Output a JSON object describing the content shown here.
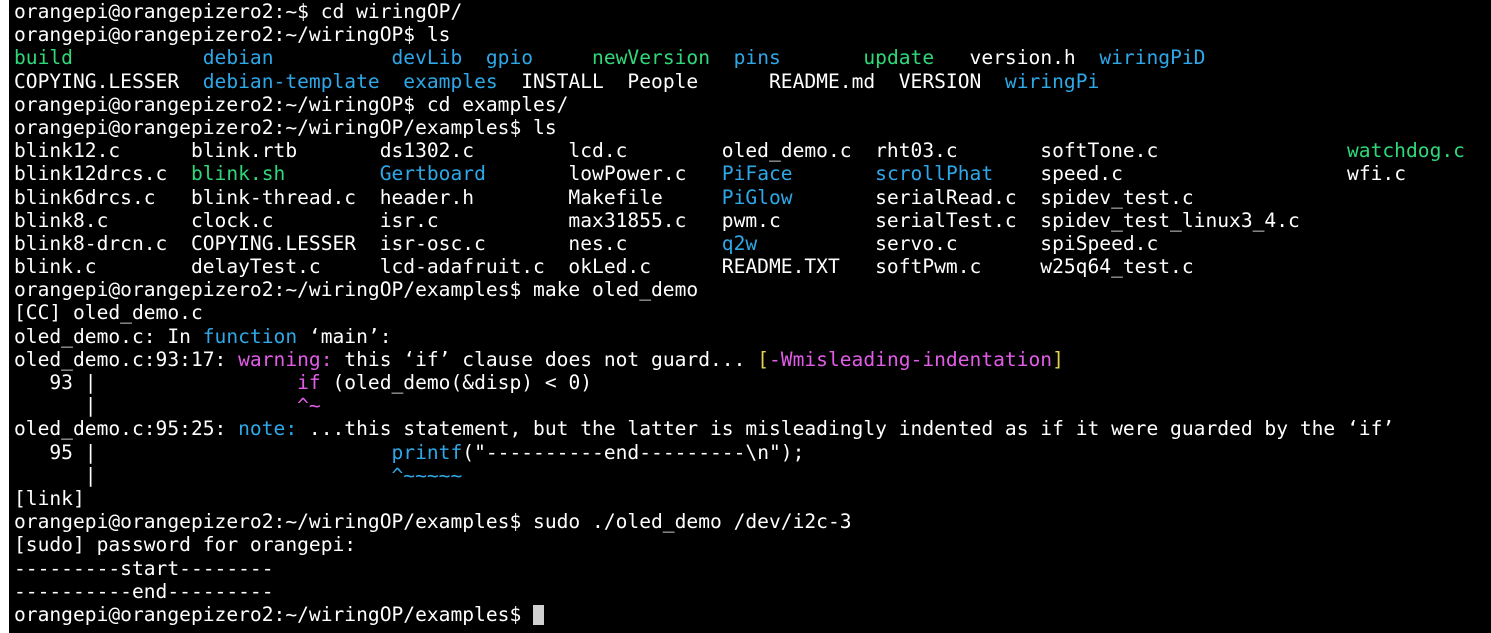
{
  "colors": {
    "background": "#000000",
    "text": "#ffffff",
    "directory": "#2ea8e8",
    "executable": "#2fd97a",
    "warning": "#e25ce8",
    "flag": "#e8d44d"
  },
  "lines": [
    [
      {
        "t": "orangepi@orangepizero2:~$ cd wiringOP/",
        "c": "white"
      }
    ],
    [
      {
        "t": "orangepi@orangepizero2:~/wiringOP$ ls",
        "c": "white"
      }
    ],
    [
      {
        "t": "build           ",
        "c": "green"
      },
      {
        "t": "debian          ",
        "c": "blue"
      },
      {
        "t": "devLib  ",
        "c": "blue"
      },
      {
        "t": "gpio     ",
        "c": "blue"
      },
      {
        "t": "newVersion  ",
        "c": "green"
      },
      {
        "t": "pins       ",
        "c": "blue"
      },
      {
        "t": "update   ",
        "c": "green"
      },
      {
        "t": "version.h  ",
        "c": "white"
      },
      {
        "t": "wiringPiD",
        "c": "blue"
      }
    ],
    [
      {
        "t": "COPYING.LESSER  ",
        "c": "white"
      },
      {
        "t": "debian-template  ",
        "c": "blue"
      },
      {
        "t": "examples  ",
        "c": "blue"
      },
      {
        "t": "INSTALL  People      README.md  VERSION  ",
        "c": "white"
      },
      {
        "t": "wiringPi",
        "c": "blue"
      }
    ],
    [
      {
        "t": "orangepi@orangepizero2:~/wiringOP$ cd examples/",
        "c": "white"
      }
    ],
    [
      {
        "t": "orangepi@orangepizero2:~/wiringOP/examples$ ls",
        "c": "white"
      }
    ],
    [
      {
        "t": "blink12.c      blink.rtb       ds1302.c        lcd.c        oled_demo.c  rht03.c       softTone.c                ",
        "c": "white"
      },
      {
        "t": "watchdog.c",
        "c": "green"
      }
    ],
    [
      {
        "t": "blink12drcs.c  ",
        "c": "white"
      },
      {
        "t": "blink.sh        ",
        "c": "green"
      },
      {
        "t": "Gertboard       ",
        "c": "blue"
      },
      {
        "t": "lowPower.c   ",
        "c": "white"
      },
      {
        "t": "PiFace       ",
        "c": "blue"
      },
      {
        "t": "scrollPhat    ",
        "c": "blue"
      },
      {
        "t": "speed.c                   wfi.c",
        "c": "white"
      }
    ],
    [
      {
        "t": "blink6drcs.c   blink-thread.c  header.h        Makefile     ",
        "c": "white"
      },
      {
        "t": "PiGlow       ",
        "c": "blue"
      },
      {
        "t": "serialRead.c  spidev_test.c",
        "c": "white"
      }
    ],
    [
      {
        "t": "blink8.c       clock.c         isr.c           max31855.c   pwm.c        serialTest.c  spidev_test_linux3_4.c",
        "c": "white"
      }
    ],
    [
      {
        "t": "blink8-drcn.c  COPYING.LESSER  isr-osc.c       nes.c        ",
        "c": "white"
      },
      {
        "t": "q2w          ",
        "c": "blue"
      },
      {
        "t": "servo.c       spiSpeed.c",
        "c": "white"
      }
    ],
    [
      {
        "t": "blink.c        delayTest.c     lcd-adafruit.c  okLed.c      README.TXT   softPwm.c     w25q64_test.c",
        "c": "white"
      }
    ],
    [
      {
        "t": "orangepi@orangepizero2:~/wiringOP/examples$ make oled_demo",
        "c": "white"
      }
    ],
    [
      {
        "t": "[CC] oled_demo.c",
        "c": "white"
      }
    ],
    [
      {
        "t": "oled_demo.c: In ",
        "c": "white"
      },
      {
        "t": "function",
        "c": "blue"
      },
      {
        "t": " ‘main’:",
        "c": "white"
      }
    ],
    [
      {
        "t": "oled_demo.c:93:17: ",
        "c": "white"
      },
      {
        "t": "warning:",
        "c": "magenta"
      },
      {
        "t": " this ‘if’ clause does not guard... ",
        "c": "white"
      },
      {
        "t": "[",
        "c": "yellow"
      },
      {
        "t": "-Wmisleading-indentation",
        "c": "magenta"
      },
      {
        "t": "]",
        "c": "yellow"
      }
    ],
    [
      {
        "t": "   93 |                 ",
        "c": "white"
      },
      {
        "t": "if",
        "c": "magenta"
      },
      {
        "t": " (oled_demo(&disp) < 0)",
        "c": "white"
      }
    ],
    [
      {
        "t": "      |                 ",
        "c": "white"
      },
      {
        "t": "^~",
        "c": "magenta"
      }
    ],
    [
      {
        "t": "oled_demo.c:95:25: ",
        "c": "white"
      },
      {
        "t": "note:",
        "c": "blue"
      },
      {
        "t": " ...this statement, but the latter is misleadingly indented as if it were guarded by the ‘if’",
        "c": "white"
      }
    ],
    [
      {
        "t": "   95 |                         ",
        "c": "white"
      },
      {
        "t": "printf",
        "c": "blue"
      },
      {
        "t": "(\"----------end---------\\n\");",
        "c": "white"
      }
    ],
    [
      {
        "t": "      |                         ",
        "c": "white"
      },
      {
        "t": "^~~~~~",
        "c": "blue"
      }
    ],
    [
      {
        "t": "[link]",
        "c": "white"
      }
    ],
    [
      {
        "t": "orangepi@orangepizero2:~/wiringOP/examples$ sudo ./oled_demo /dev/i2c-3",
        "c": "white"
      }
    ],
    [
      {
        "t": "[sudo] password for orangepi:",
        "c": "white"
      }
    ],
    [
      {
        "t": "---------start--------",
        "c": "white"
      }
    ],
    [
      {
        "t": "----------end---------",
        "c": "white"
      }
    ],
    [
      {
        "t": "orangepi@orangepizero2:~/wiringOP/examples$ ",
        "c": "white"
      }
    ]
  ],
  "cursor": "block"
}
